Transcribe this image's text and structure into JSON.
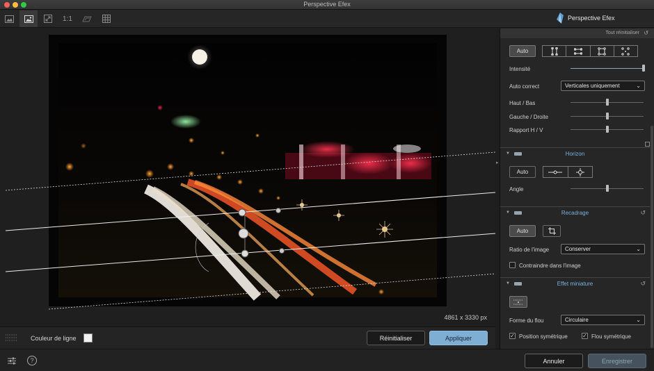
{
  "window": {
    "title": "Perspective Efex"
  },
  "brand": {
    "name": "Perspective Efex"
  },
  "toolbar": {
    "one_to_one_label": "1:1"
  },
  "canvas": {
    "dimensions": "4861 x 3330 px"
  },
  "optbar": {
    "line_color_label": "Couleur de ligne",
    "reset_label": "Réinitialiser",
    "apply_label": "Appliquer"
  },
  "footer": {
    "cancel_label": "Annuler",
    "save_label": "Enregistrer"
  },
  "panel": {
    "reset_all_label": "Tout réinitialiser",
    "perspective": {
      "auto_label": "Auto",
      "intensity_label": "Intensité",
      "intensity_value": 1.0,
      "auto_correct_label": "Auto correct",
      "auto_correct_value": "Verticales uniquement",
      "vertical_label": "Haut / Bas",
      "vertical_value": 0.5,
      "horizontal_label": "Gauche / Droite",
      "horizontal_value": 0.5,
      "ratio_label": "Rapport H / V",
      "ratio_value": 0.5
    },
    "horizon": {
      "title": "Horizon",
      "auto_label": "Auto",
      "angle_label": "Angle",
      "angle_value": 0.5
    },
    "crop": {
      "title": "Recadrage",
      "auto_label": "Auto",
      "ratio_label": "Ratio de l'image",
      "ratio_value": "Conserver",
      "constrain_label": "Contraindre dans l'image",
      "constrain_checked": false
    },
    "miniature": {
      "title": "Effet miniature",
      "blur_shape_label": "Forme du flou",
      "blur_shape_value": "Circulaire",
      "sym_position_label": "Position symétrique",
      "sym_position_checked": true,
      "sym_blur_label": "Flou symétrique",
      "sym_blur_checked": true
    }
  },
  "colors": {
    "accent": "#78b3e0",
    "apply_button": "#7faed3",
    "save_button_disabled": "#46535e",
    "line_color": "#f2f2f2"
  }
}
